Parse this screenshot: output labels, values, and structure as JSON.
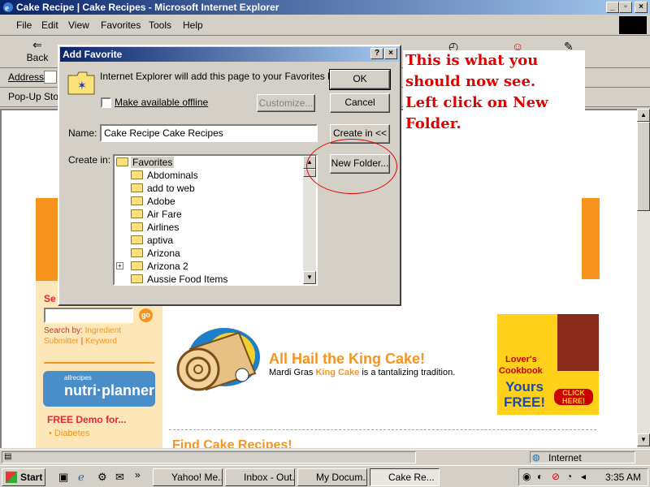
{
  "window": {
    "title": "Cake Recipe | Cake Recipes - Microsoft Internet Explorer",
    "icon": "ie-icon"
  },
  "menu": [
    "File",
    "Edit",
    "View",
    "Favorites",
    "Tools",
    "Help"
  ],
  "toolbar": {
    "back_label": "Back"
  },
  "addressbar": {
    "label": "Address"
  },
  "popbar": {
    "label": "Pop-Up Stop"
  },
  "dialog": {
    "title": "Add Favorite",
    "message": "Internet Explorer will add this page to your Favorites list.",
    "offline_label": "Make available offline",
    "customize_label": "Customize...",
    "ok_label": "OK",
    "cancel_label": "Cancel",
    "name_label": "Name:",
    "name_value": "Cake Recipe  Cake Recipes",
    "create_in_label": "Create in:",
    "create_in_button": "Create in <<",
    "new_folder_button": "New Folder...",
    "folders": [
      "Favorites",
      "Abdominals",
      "add to web",
      "Adobe",
      "Air Fare",
      "Airlines",
      "aptiva",
      "Arizona",
      "Arizona 2",
      "Aussie Food Items"
    ]
  },
  "callout": {
    "lines": [
      "This is what you",
      "should now see.",
      "Left click on New",
      "Folder."
    ]
  },
  "page": {
    "search_label": "Se",
    "search_by": "Search by:",
    "ingredient": "Ingredient",
    "submitter": "Submitter",
    "sep": "|",
    "keyword": "Keyword",
    "go": "go",
    "nutri_small": "allrecipes",
    "nutri_big": "nutri·planner",
    "free_demo": "FREE Demo for...",
    "diabetes": "• Diabetes",
    "headline": "All Hail the King Cake!",
    "sub_before": "Mardi Gras ",
    "sub_link": "King Cake",
    "sub_after": " is a tantalizing tradition.",
    "find": "Find Cake Recipes!",
    "ad_lovers": "Lover's",
    "ad_cookbook": "Cookbook",
    "ad_yours": "Yours",
    "ad_free": "FREE!",
    "ad_click": "CLICK HERE!"
  },
  "status": {
    "zone": "Internet"
  },
  "taskbar": {
    "start": "Start",
    "tasks": [
      "Yahoo! Me...",
      "Inbox - Out...",
      "My Docum...",
      "Cake Re..."
    ],
    "clock": "3:35 AM"
  }
}
